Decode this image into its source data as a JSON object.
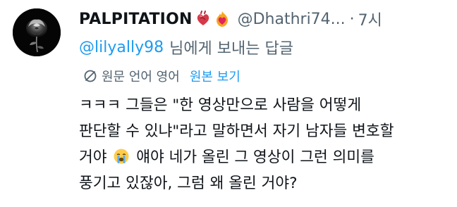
{
  "tweet": {
    "display_name": "PALPITATION",
    "emojis": [
      "anatomical-heart-emoji",
      "heart-on-fire-emoji"
    ],
    "handle": "@Dhathri74...",
    "separator": "·",
    "time": "7시",
    "reply_to_mention": "@lilyally98",
    "reply_to_suffix": "님에게 보내는 답글",
    "translation": {
      "label": "원문 언어 영어",
      "show_original": "원본 보기"
    },
    "body": {
      "line1": "ㅋㅋㅋ 그들은 \"한 영상만으로 사람을 어떻게",
      "line2": "판단할 수 있냐\"라고 말하면서 자기 남자들 변호할",
      "line3_before_emoji": "거야",
      "line3_after_emoji": "얘야 네가 올린 그 영상이 그런 의미를",
      "line4": "풍기고 있잖아, 그럼 왜 올린 거야?",
      "inline_emoji": "crying-face-emoji"
    }
  },
  "colors": {
    "text_primary": "#0f1419",
    "text_secondary": "#536471",
    "link_blue": "#1d9bf0"
  }
}
